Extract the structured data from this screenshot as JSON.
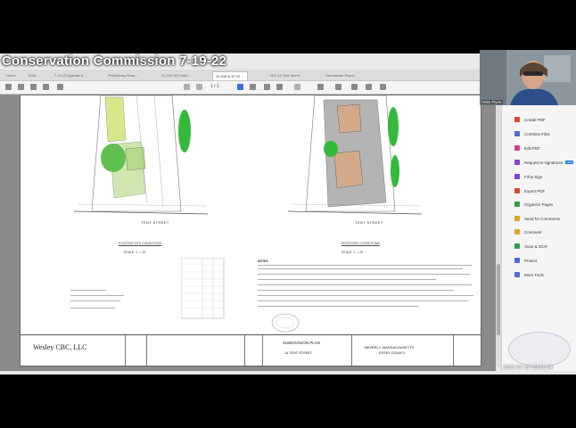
{
  "meeting": {
    "title": "Conservation Commission 7-19-22",
    "timestamp": "2022-07-19 19:51:24"
  },
  "viewer": {
    "menu": [
      "Home",
      "Tools"
    ],
    "tabs": [
      {
        "label": "7-19-22 Agenda & ..."
      },
      {
        "label": "Preliminary Resp..."
      },
      {
        "label": "22-035 NOI Narr..."
      },
      {
        "label": "22-035 & 37 22 ...",
        "active": true
      },
      {
        "label": "NOI 14 Tent Street..."
      },
      {
        "label": "Stormwater Repor..."
      }
    ],
    "page_indicator": "1 / 1"
  },
  "document": {
    "street_left": "TENT STREET",
    "street_right": "TENT STREET",
    "caption_left": "EXISTING SITE CONDITIONS",
    "caption_right": "PROPOSED CONDITIONS",
    "scale_left": "SCALE: 1\" = 20'",
    "scale_right": "SCALE: 1\" = 20'",
    "company": "Wesley CBC, LLC",
    "plan_title": "SUBDIVISION PLAN",
    "plan_address": "14 TENT STREET",
    "town": "BEVERLY, MASSACHUSETTS",
    "county": "ESSEX COUNTY",
    "notes_heading": "NOTES"
  },
  "tools_panel": {
    "items": [
      {
        "label": "Create PDF",
        "icon": "create-pdf-icon",
        "color": "#e0462d"
      },
      {
        "label": "Combine Files",
        "icon": "combine-files-icon",
        "color": "#4f6bd8"
      },
      {
        "label": "Edit PDF",
        "icon": "edit-pdf-icon",
        "color": "#d33f8f"
      },
      {
        "label": "Request E-signatures",
        "icon": "request-signatures-icon",
        "color": "#8a3fd1",
        "badge": "NEW"
      },
      {
        "label": "Fill & Sign",
        "icon": "fill-sign-icon",
        "color": "#7a3fd8"
      },
      {
        "label": "Export PDF",
        "icon": "export-pdf-icon",
        "color": "#e0462d"
      },
      {
        "label": "Organize Pages",
        "icon": "organize-pages-icon",
        "color": "#2f9e44"
      },
      {
        "label": "Send for Comments",
        "icon": "send-comments-icon",
        "color": "#e0a42d"
      },
      {
        "label": "Comment",
        "icon": "comment-icon",
        "color": "#e0a42d"
      },
      {
        "label": "Scan & OCR",
        "icon": "scan-ocr-icon",
        "color": "#2f9e44"
      },
      {
        "label": "Protect",
        "icon": "protect-icon",
        "color": "#4f6bd8"
      },
      {
        "label": "More Tools",
        "icon": "more-tools-icon",
        "color": "#4f6bd8"
      }
    ]
  },
  "participant": {
    "name": "Miss Flynn"
  }
}
